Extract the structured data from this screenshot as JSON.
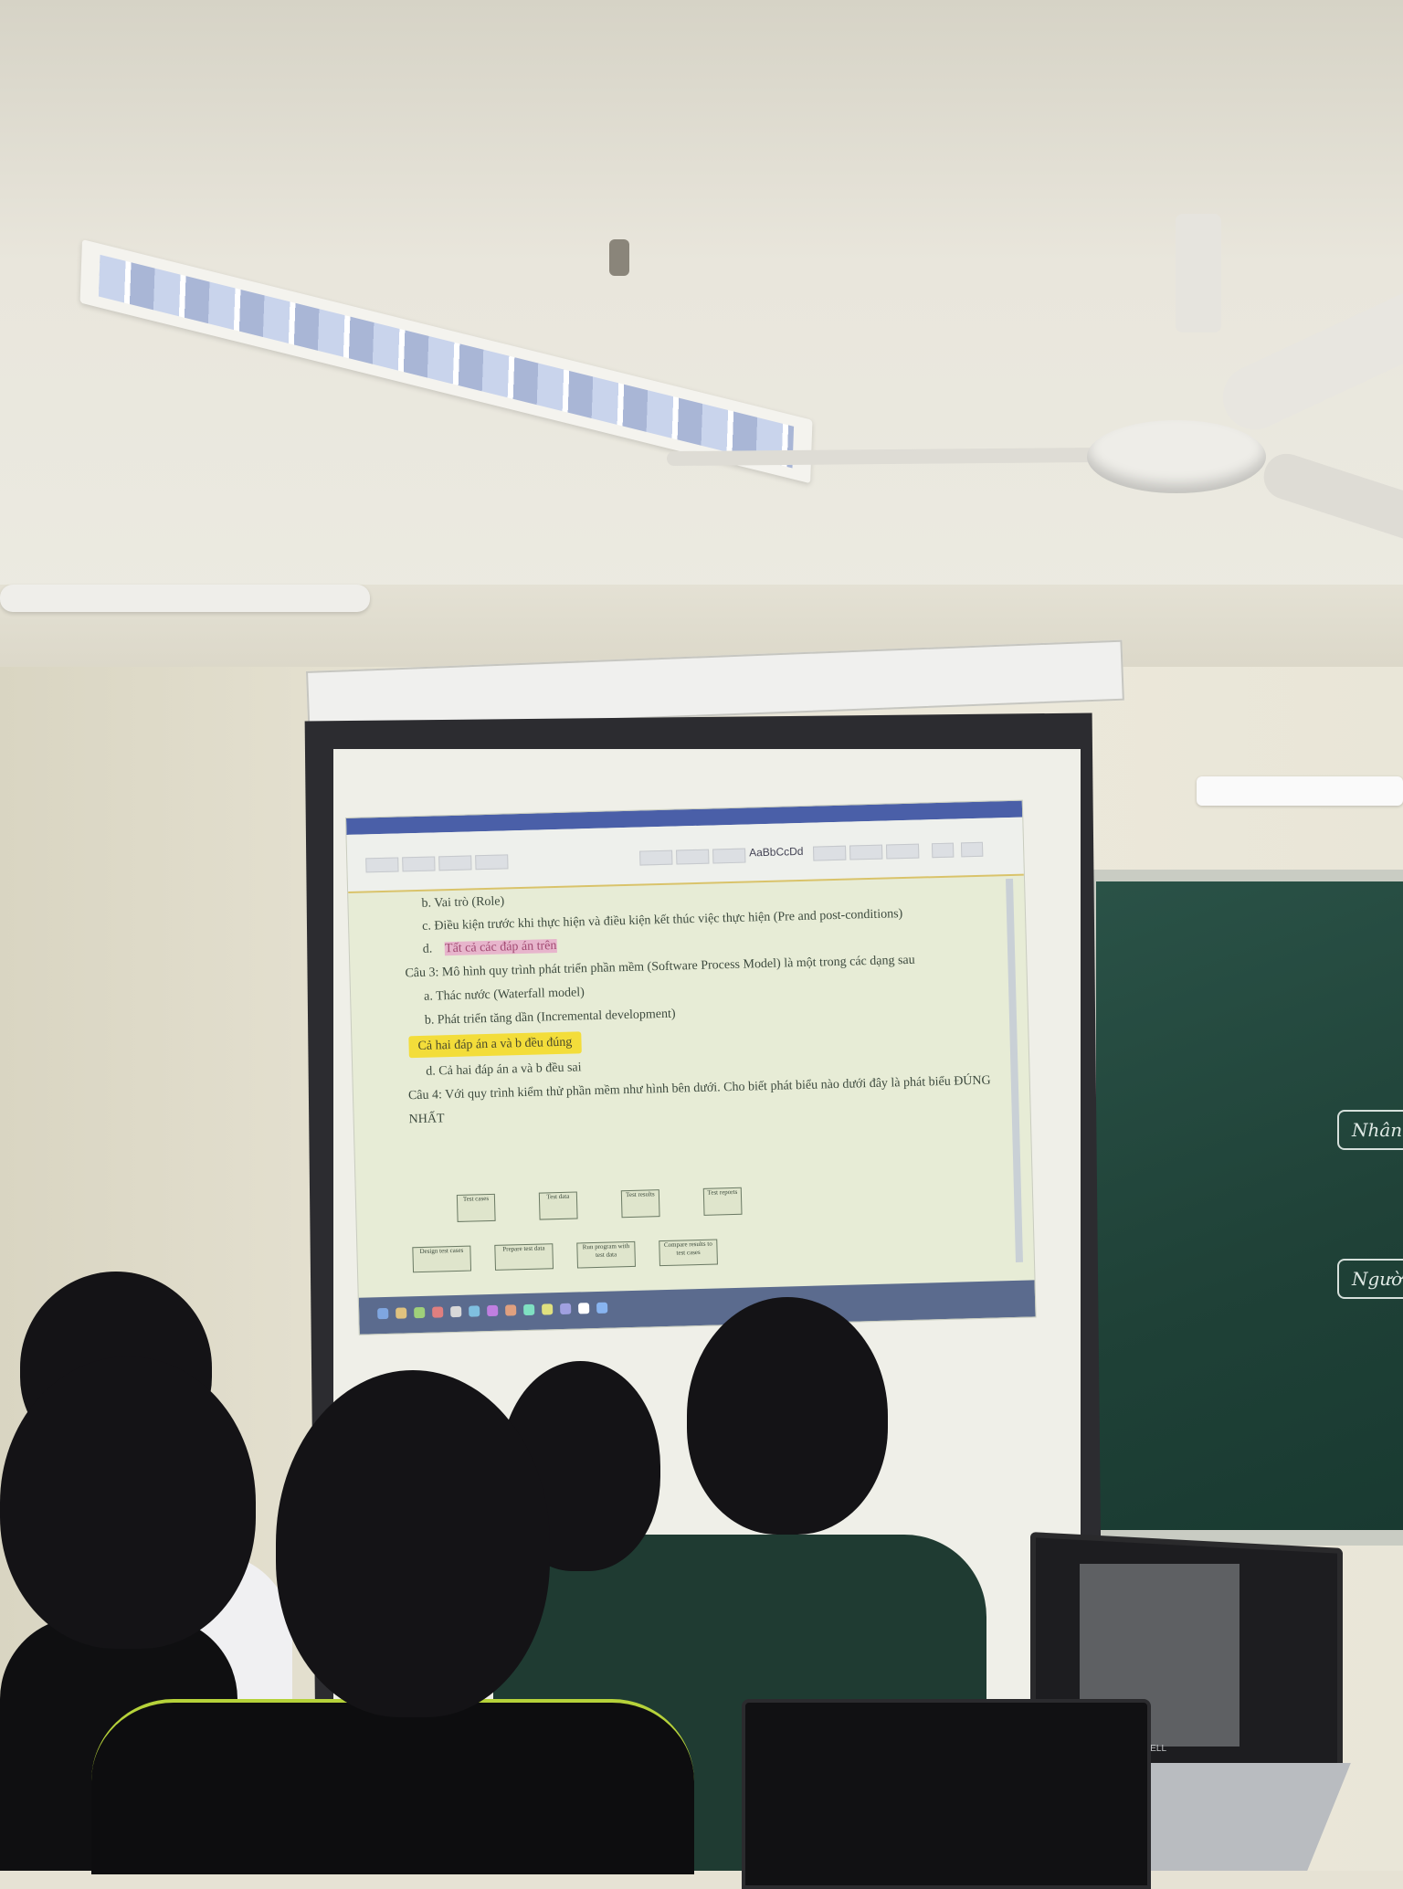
{
  "projected_window": {
    "title": "",
    "ribbon_style_label": "AaBbCcDd"
  },
  "document": {
    "lines": [
      {
        "id": "b-role",
        "text": "b.   Vai trò (Role)",
        "indent": true,
        "highlight": "none"
      },
      {
        "id": "c-cond",
        "text": "c.   Điều kiện trước khi thực hiện và điều kiện kết thúc việc thực hiện (Pre and post-conditions)",
        "indent": true,
        "highlight": "none"
      },
      {
        "id": "d-all",
        "text": "Tất cả các đáp án trên",
        "prefix": "d.",
        "indent": true,
        "highlight": "pink"
      },
      {
        "id": "q3",
        "text": "Câu 3: Mô hình quy trình phát triển phần mềm (Software Process Model) là một trong các dạng sau",
        "indent": false,
        "highlight": "none"
      },
      {
        "id": "q3a",
        "text": "a.   Thác nước (Waterfall model)",
        "indent": true,
        "highlight": "none"
      },
      {
        "id": "q3b",
        "text": "b.   Phát triển tăng dần (Incremental development)",
        "indent": true,
        "highlight": "none"
      },
      {
        "id": "q3c",
        "text": "Cả hai đáp án a và b đều đúng",
        "indent": true,
        "highlight": "yellow"
      },
      {
        "id": "q3d",
        "text": "d.   Cả hai đáp án a và b đều sai",
        "indent": true,
        "highlight": "none"
      },
      {
        "id": "q4",
        "text": "Câu 4: Với quy trình kiểm thử phần mềm như hình bên dưới. Cho biết phát biểu nào dưới đây là phát biểu ĐÚNG",
        "indent": false,
        "highlight": "none"
      },
      {
        "id": "q4b",
        "text": "NHẤT",
        "indent": false,
        "highlight": "none"
      }
    ]
  },
  "diagram": {
    "top_boxes": [
      "Test cases",
      "Test data",
      "Test results",
      "Test reports"
    ],
    "bottom_boxes": [
      "Design test cases",
      "Prepare test data",
      "Run program with test data",
      "Compare results to test cases"
    ]
  },
  "board": {
    "label_1": "Nhân v",
    "label_2": "Người k"
  },
  "laptop": {
    "brand": "DELL"
  },
  "colors": {
    "highlight_yellow": "#f3dd3a",
    "highlight_pink": "#e7b5cc",
    "board_green": "#254a40",
    "word_titlebar": "#4a5fa8"
  }
}
